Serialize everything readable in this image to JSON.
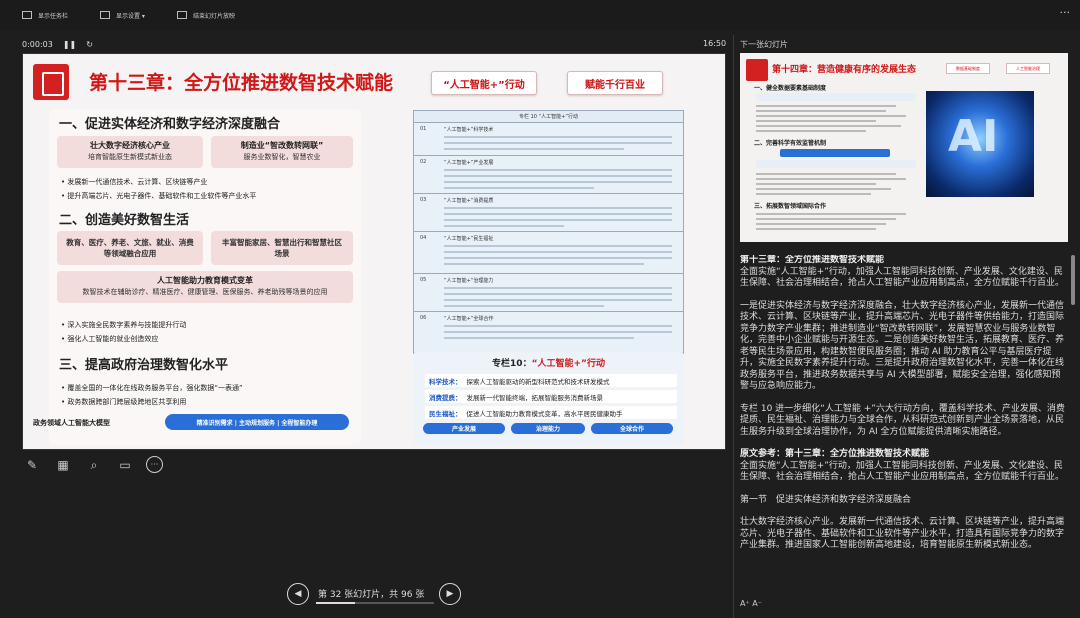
{
  "toolbar": {
    "show_taskbar": "显示任务栏",
    "display_settings": "显示设置 ▾",
    "end_show": "结束幻灯片放映",
    "more": "···"
  },
  "presenter": {
    "elapsed": "0:00:03",
    "pause_icon": "pause-icon",
    "reset_icon": "reset-icon",
    "clock": "16:50",
    "next_slide_label": "下一张幻灯片"
  },
  "slide": {
    "title": "第十三章：全方位推进数智技术赋能",
    "badge1": "“人工智能+”行动",
    "badge2": "赋能千行百业",
    "sec1": "一、促进实体经济和数字经济深度融合",
    "pill1_title": "壮大数字经济核心产业",
    "pill1_sub": "培育智能原生新模式新业态",
    "pill2_title": "制造业“智改数转网联”",
    "pill2_sub": "服务业数智化，智慧农业",
    "bullet1": "• 发展新一代通信技术、云计算、区块链等产业",
    "bullet2": "• 提升高端芯片、光电子器件、基础软件和工业软件等产业水平",
    "sec2": "二、创造美好数智生活",
    "pill3": "教育、医疗、养老、文旅、就业、消费等领域融合应用",
    "pill4": "丰富智能家居、智慧出行和智慧社区场景",
    "pill5_title": "人工智能助力教育模式变革",
    "pill5_sub": "数智技术在辅助诊疗、精准医疗、健康管理、医保服务、养老助残等场景的应用",
    "bullet3": "• 深入实施全民数字素养与技能提升行动",
    "bullet4": "• 强化人工智能的就业创造效应",
    "sec3": "三、提高政府治理数智化水平",
    "bullet5": "• 覆盖全国的一体化在线政务服务平台，强化数据“一表通”",
    "bullet6": "• 政务数据跨部门跨层级跨地区共享利用",
    "gov_label": "政务领域人工智能大模型",
    "gov_btn": "精准识别需求 | 主动规划服务 | 全程智能办理",
    "table_head": "专栏 10   “人工智能+”行动",
    "table_rows": [
      {
        "num": "01",
        "name": "“人工智能+”科学技术"
      },
      {
        "num": "02",
        "name": "“人工智能+”产业发展"
      },
      {
        "num": "03",
        "name": "“人工智能+”消费提质"
      },
      {
        "num": "04",
        "name": "“人工智能+”民生福祉"
      },
      {
        "num": "05",
        "name": "“人工智能+”治理能力"
      },
      {
        "num": "06",
        "name": "“人工智能+”全球合作"
      }
    ],
    "col_title_prefix": "专栏10：",
    "col_title_main": "“人工智能+”行动",
    "col_rows": [
      {
        "k": "科学技术：",
        "v": "探索人工智能驱动的新型科研范式和技术研发模式"
      },
      {
        "k": "消费提质：",
        "v": "发展新一代智能终端，拓展智能服务消费新场景"
      },
      {
        "k": "民生福祉：",
        "v": "促进人工智能助力教育模式变革，高水平居民健康助手"
      }
    ],
    "col_btns": [
      "产业发展",
      "治理能力",
      "全球合作"
    ]
  },
  "tools": [
    "pen-icon",
    "slides-grid-icon",
    "zoom-icon",
    "screen-icon",
    "more-icon"
  ],
  "nav": {
    "counter": "第 32 张幻灯片，共 96 张",
    "current": 32,
    "total": 96
  },
  "next_slide": {
    "title": "第十四章：营造健康有序的发展生态",
    "badge1": "数据基础制度",
    "badge2": "人工智能治理",
    "sec1": "一、健全数据要素基础制度",
    "sec2": "二、完善科学有效监管机制",
    "sec3": "三、拓展数智领域国际合作",
    "ai_text": "AI"
  },
  "notes": {
    "p1_title": "第十三章：全方位推进数智技术赋能",
    "p1": "全面实施“人工智能+”行动，加强人工智能同科技创新、产业发展、文化建设、民生保障、社会治理相结合，抢占人工智能产业应用制高点，全方位赋能千行百业。",
    "p2": "一是促进实体经济与数字经济深度融合，壮大数字经济核心产业，发展新一代通信技术、云计算、区块链等产业，提升高端芯片、光电子器件等供给能力，打造国际竞争力数字产业集群；推进制造业“智改数转网联”，发展智慧农业与服务业数智化，完善中小企业赋能与开源生态。二是创造美好数智生活，拓展教育、医疗、养老等民生场景应用，构建数智便民服务圈；推动 AI 助力教育公平与基层医疗提升，实施全民数字素养提升行动。三是提升政府治理数智化水平，完善一体化在线政务服务平台，推进政务数据共享与 AI 大模型部署，赋能安全治理，强化感知预警与应急响应能力。",
    "p3": "专栏 10 进一步细化“人工智能 +”六大行动方向，覆盖科学技术、产业发展、消费提质、民生福祉、治理能力与全球合作，从科研范式创新到产业全场景落地，从民生服务升级到全球治理协作，为 AI 全方位赋能提供清晰实施路径。",
    "p4_title": "原文参考：第十三章：全方位推进数智技术赋能",
    "p4": "全面实施“人工智能+”行动，加强人工智能同科技创新、产业发展、文化建设、民生保障、社会治理相结合，抢占人工智能产业应用制高点，全方位赋能千行百业。",
    "p5": "第一节　促进实体经济和数字经济深度融合",
    "p6": "壮大数字经济核心产业。发展新一代通信技术、云计算、区块链等产业，提升高端芯片、光电子器件、基础软件和工业软件等产业水平，打造具有国际竞争力的数字产业集群。推进国家人工智能创新高地建设，培育智能原生新模式新业态。"
  },
  "font_ctl": "A⁺  A⁻"
}
